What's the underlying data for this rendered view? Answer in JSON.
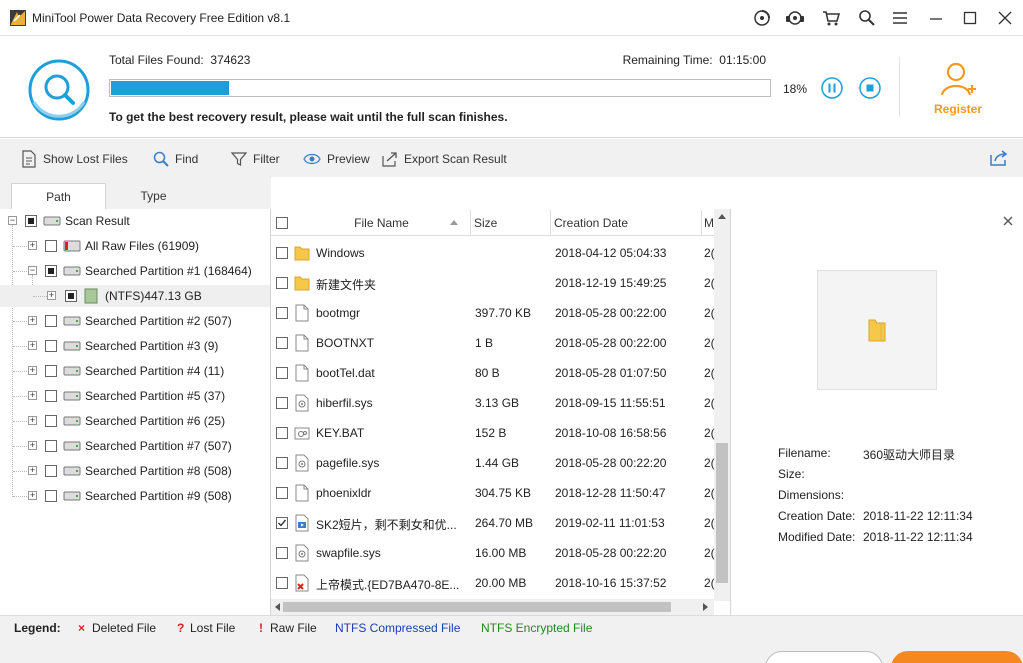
{
  "window": {
    "title": "MiniTool Power Data Recovery Free Edition v8.1"
  },
  "scan": {
    "total_label": "Total Files Found:",
    "total_value": "374623",
    "remaining_label": "Remaining Time:",
    "remaining_value": "01:15:00",
    "progress_percent_text": "18%",
    "progress_fraction": 0.18,
    "hint": "To get the best recovery result, please wait until the full scan finishes."
  },
  "register": {
    "label": "Register"
  },
  "toolbar": {
    "show_lost_files": "Show Lost Files",
    "find": "Find",
    "filter": "Filter",
    "preview": "Preview",
    "export": "Export Scan Result"
  },
  "tabs": {
    "path": "Path",
    "type": "Type"
  },
  "tree": {
    "root": "Scan Result",
    "items": [
      {
        "label": "All Raw Files (61909)",
        "icon": "raw-files-icon"
      },
      {
        "label": "Searched Partition #1 (168464)",
        "icon": "drive-icon"
      },
      {
        "label": "(NTFS)447.13 GB",
        "icon": "volume-icon"
      },
      {
        "label": "Searched Partition #2 (507)",
        "icon": "drive-icon"
      },
      {
        "label": "Searched Partition #3 (9)",
        "icon": "drive-icon"
      },
      {
        "label": "Searched Partition #4 (11)",
        "icon": "drive-icon"
      },
      {
        "label": "Searched Partition #5 (37)",
        "icon": "drive-icon"
      },
      {
        "label": "Searched Partition #6 (25)",
        "icon": "drive-icon"
      },
      {
        "label": "Searched Partition #7 (507)",
        "icon": "drive-icon"
      },
      {
        "label": "Searched Partition #8 (508)",
        "icon": "drive-icon"
      },
      {
        "label": "Searched Partition #9 (508)",
        "icon": "drive-icon"
      }
    ]
  },
  "filelist": {
    "columns": {
      "name": "File Name",
      "size": "Size",
      "date": "Creation Date",
      "more": "M"
    },
    "rows": [
      {
        "name": "Windows",
        "size": "",
        "date": "2018-04-12 05:04:33",
        "more": "2(",
        "icon": "folder-icon",
        "checked": false
      },
      {
        "name": "新建文件夹",
        "size": "",
        "date": "2018-12-19 15:49:25",
        "more": "2(",
        "icon": "folder-icon",
        "checked": false
      },
      {
        "name": "bootmgr",
        "size": "397.70 KB",
        "date": "2018-05-28 00:22:00",
        "more": "2(",
        "icon": "file-icon",
        "checked": false
      },
      {
        "name": "BOOTNXT",
        "size": "1 B",
        "date": "2018-05-28 00:22:00",
        "more": "2(",
        "icon": "file-icon",
        "checked": false
      },
      {
        "name": "bootTel.dat",
        "size": "80 B",
        "date": "2018-05-28 01:07:50",
        "more": "2(",
        "icon": "file-icon",
        "checked": false
      },
      {
        "name": "hiberfil.sys",
        "size": "3.13 GB",
        "date": "2018-09-15 11:55:51",
        "more": "2(",
        "icon": "system-file-icon",
        "checked": false
      },
      {
        "name": "KEY.BAT",
        "size": "152 B",
        "date": "2018-10-08 16:58:56",
        "more": "2(",
        "icon": "batch-file-icon",
        "checked": false
      },
      {
        "name": "pagefile.sys",
        "size": "1.44 GB",
        "date": "2018-05-28 00:22:20",
        "more": "2(",
        "icon": "system-file-icon",
        "checked": false
      },
      {
        "name": "phoenixldr",
        "size": "304.75 KB",
        "date": "2018-12-28 11:50:47",
        "more": "2(",
        "icon": "file-icon",
        "checked": false
      },
      {
        "name": "SK2短片，剩不剩女和优...",
        "size": "264.70 MB",
        "date": "2019-02-11 11:01:53",
        "more": "2(",
        "icon": "video-file-icon",
        "checked": true
      },
      {
        "name": "swapfile.sys",
        "size": "16.00 MB",
        "date": "2018-05-28 00:22:20",
        "more": "2(",
        "icon": "system-file-icon",
        "checked": false
      },
      {
        "name": "上帝模式.{ED7BA470-8E...",
        "size": "20.00 MB",
        "date": "2018-10-16 15:37:52",
        "more": "2(",
        "icon": "deleted-file-icon",
        "checked": false
      }
    ]
  },
  "preview": {
    "filename_label": "Filename:",
    "filename_value": "360驱动大师目录",
    "size_label": "Size:",
    "dimensions_label": "Dimensions:",
    "creation_label": "Creation Date:",
    "creation_value": "2018-11-22 12:11:34",
    "modified_label": "Modified Date:",
    "modified_value": "2018-11-22 12:11:34"
  },
  "legend": {
    "title": "Legend:",
    "deleted": "Deleted File",
    "lost": "Lost File",
    "raw": "Raw File",
    "compressed": "NTFS Compressed File",
    "encrypted": "NTFS Encrypted File",
    "deleted_mark": "×",
    "lost_mark": "?",
    "raw_mark": "!"
  },
  "colors": {
    "accent": "#1e9fda",
    "register": "#f39a1f",
    "deleted": "#e02020",
    "compressed": "#1a3db8",
    "encrypted": "#1f8a1f"
  }
}
